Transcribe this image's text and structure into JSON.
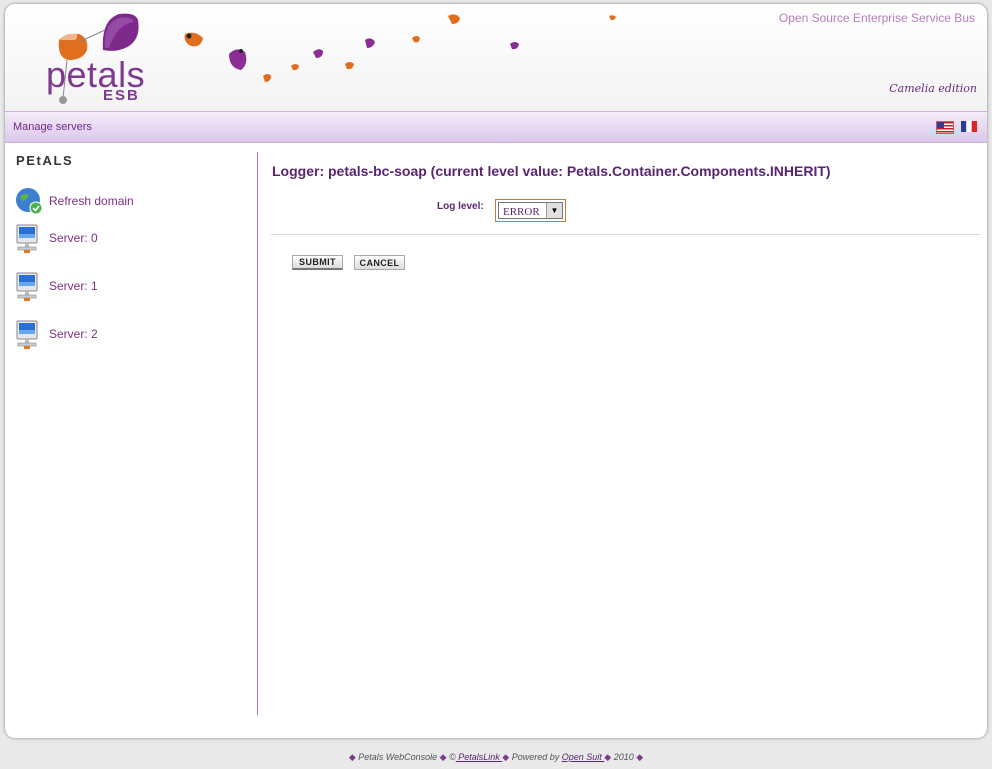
{
  "header": {
    "logo_text": "petals",
    "logo_sub": "ESB",
    "tagline": "Open Source Enterprise Service Bus",
    "edition": "Camelia edition"
  },
  "nav": {
    "manage_servers": "Manage servers",
    "flags": [
      "us-flag-icon",
      "fr-flag-icon"
    ]
  },
  "sidebar": {
    "title": "PEtALS",
    "items": [
      {
        "label": "Refresh domain",
        "icon": "globe-refresh-icon"
      },
      {
        "label": "Server: 0",
        "icon": "server-icon"
      },
      {
        "label": "Server: 1",
        "icon": "server-icon"
      },
      {
        "label": "Server: 2",
        "icon": "server-icon"
      }
    ]
  },
  "main": {
    "title": "Logger: petals-bc-soap (current level value: Petals.Container.Components.INHERIT)",
    "log_level_label": "Log level:",
    "log_level_value": "ERROR",
    "submit_label": "SUBMIT",
    "cancel_label": "CANCEL"
  },
  "footer": {
    "part1": "Petals WebConsole",
    "copyright": "©",
    "company_link": " PetalsLink ",
    "powered_by": "Powered by",
    "opensuit_link": "Open Suit ",
    "year": "2010"
  },
  "colors": {
    "brand_purple": "#7d3a8e",
    "accent_orange": "#e07a2a",
    "nav_bg": "#e8d9f2"
  }
}
